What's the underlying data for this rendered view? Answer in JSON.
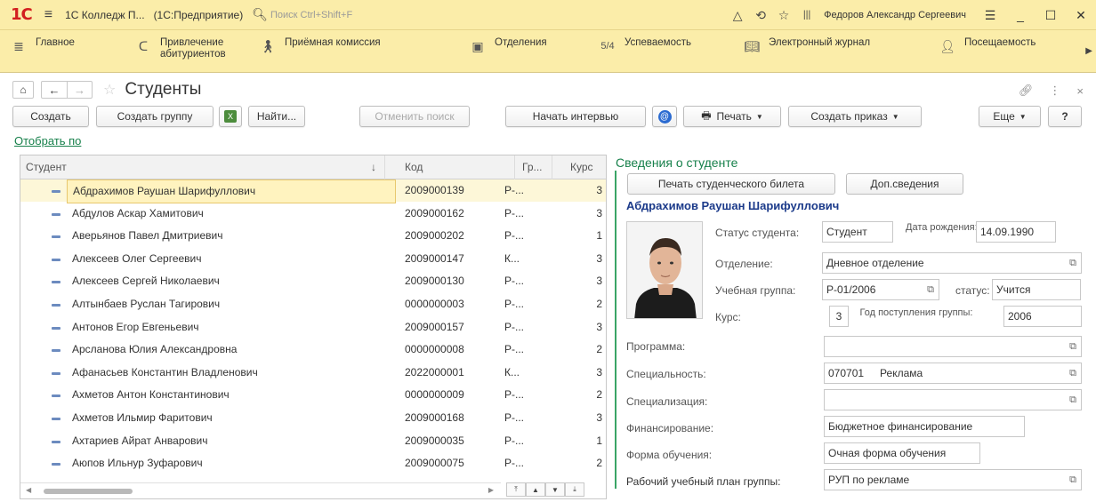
{
  "titlebar": {
    "logo": "1С",
    "menu_icon": "hamburger-icon",
    "app_name": "1С Колледж П...",
    "platform": "(1С:Предприятие)",
    "search_placeholder": "Поиск Ctrl+Shift+F",
    "user": "Федоров Александр Сергеевич"
  },
  "sections": [
    {
      "icon": "hamburger-icon",
      "label": "Главное"
    },
    {
      "icon": "magnet-icon",
      "label": "Привлечение абитуриентов"
    },
    {
      "icon": "person-icon",
      "label": "Приёмная комиссия"
    },
    {
      "icon": "document-icon",
      "label": "Отделения"
    },
    {
      "icon": "grade-icon",
      "label": "Успеваемость",
      "badge": "5/4"
    },
    {
      "icon": "book-icon",
      "label": "Электронный журнал"
    },
    {
      "icon": "attendance-icon",
      "label": "Посещаемость"
    }
  ],
  "form": {
    "title": "Студенты",
    "filter_link": "Отобрать по"
  },
  "toolbar": {
    "create": "Создать",
    "create_group": "Создать группу",
    "find": "Найти...",
    "cancel_search": "Отменить поиск",
    "start_interview": "Начать интервью",
    "print": "Печать",
    "create_order": "Создать приказ",
    "more": "Еще",
    "help": "?"
  },
  "table": {
    "columns": [
      "Студент",
      "Код",
      "Гр...",
      "Курс"
    ],
    "rows": [
      {
        "name": "Абдрахимов Раушан Шарифуллович",
        "code": "2009000139",
        "group": "Р-...",
        "course": "3"
      },
      {
        "name": "Абдулов Аскар Хамитович",
        "code": "2009000162",
        "group": "Р-...",
        "course": "3"
      },
      {
        "name": "Аверьянов Павел Дмитриевич",
        "code": "2009000202",
        "group": "Р-...",
        "course": "1"
      },
      {
        "name": "Алексеев Олег Сергеевич",
        "code": "2009000147",
        "group": "К...",
        "course": "3"
      },
      {
        "name": "Алексеев Сергей Николаевич",
        "code": "2009000130",
        "group": "Р-...",
        "course": "3"
      },
      {
        "name": "Алтынбаев Руслан Тагирович",
        "code": "0000000003",
        "group": "Р-...",
        "course": "2"
      },
      {
        "name": "Антонов Егор Евгеньевич",
        "code": "2009000157",
        "group": "Р-...",
        "course": "3"
      },
      {
        "name": "Арсланова Юлия Александровна",
        "code": "0000000008",
        "group": "Р-...",
        "course": "2"
      },
      {
        "name": "Афанасьев Константин Владленович",
        "code": "2022000001",
        "group": "К...",
        "course": "3"
      },
      {
        "name": "Ахметов Антон Константинович",
        "code": "0000000009",
        "group": "Р-...",
        "course": "2"
      },
      {
        "name": "Ахметов Ильмир Фаритович",
        "code": "2009000168",
        "group": "Р-...",
        "course": "3"
      },
      {
        "name": "Ахтариев Айрат Анварович",
        "code": "2009000035",
        "group": "Р-...",
        "course": "1"
      },
      {
        "name": "Аюпов Ильнур Зуфарович",
        "code": "2009000075",
        "group": "Р-...",
        "course": "2"
      }
    ]
  },
  "details": {
    "title": "Сведения о студенте",
    "print_card": "Печать студенческого билета",
    "extra": "Доп.сведения",
    "student_name": "Абдрахимов Раушан Шарифуллович",
    "status_label": "Статус студента:",
    "status_value": "Студент",
    "birth_label": "Дата рождения:",
    "birth_value": "14.09.1990",
    "dept_label": "Отделение:",
    "dept_value": "Дневное отделение",
    "group_label": "Учебная группа:",
    "group_value": "Р-01/2006",
    "gstatus_label": "статус:",
    "gstatus_value": "Учится",
    "course_label": "Курс:",
    "course_value": "3",
    "year_label": "Год поступления группы:",
    "year_value": "2006",
    "program_label": "Программа:",
    "program_value": "",
    "spec_label": "Специальность:",
    "spec_code": "070701",
    "spec_value": "Реклама",
    "specz_label": "Специализация:",
    "specz_value": "",
    "fin_label": "Финансирование:",
    "fin_value": "Бюджетное финансирование",
    "form_label": "Форма обучения:",
    "form_value": "Очная форма обучения",
    "plan_label": "Рабочий учебный план группы:",
    "plan_value": "РУП по рекламе"
  },
  "colors": {
    "accent_green": "#17804b",
    "title_bg": "#fbeda9",
    "name_blue": "#1b3a8a"
  }
}
